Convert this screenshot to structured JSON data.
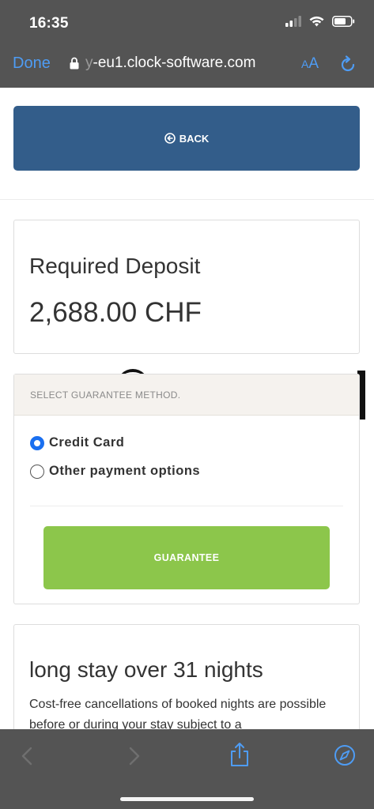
{
  "status_bar": {
    "time": "16:35"
  },
  "browser": {
    "done_label": "Done",
    "url_faded": "y",
    "url_main": "-eu1.clock-software.com",
    "text_size_label_small": "A",
    "text_size_label_large": "A"
  },
  "page": {
    "back_label": "BACK",
    "deposit": {
      "title": "Required Deposit",
      "amount": "2,688.00 CHF"
    },
    "guarantee": {
      "header": "SELECT GUARANTEE METHOD.",
      "options": [
        {
          "label": "Credit Card",
          "selected": true
        },
        {
          "label": "Other payment options",
          "selected": false
        }
      ],
      "button_label": "GUARANTEE"
    },
    "stay": {
      "title": "long stay over 31 nights",
      "description": "Cost-free cancellations of booked nights are possible before or during your stay subject to a"
    }
  },
  "colors": {
    "primary": "#335d8a",
    "accent_green": "#8cc64b",
    "radio_selected": "#1a6ff0",
    "browser_chrome": "#545454",
    "browser_link": "#4e9cf4"
  },
  "icons": {
    "back": "circle-left-arrow-icon",
    "secure": "lock-icon",
    "reload": "reload-icon",
    "nav_back": "chevron-left-icon",
    "nav_forward": "chevron-right-icon",
    "share": "share-icon",
    "compass": "compass-icon"
  }
}
